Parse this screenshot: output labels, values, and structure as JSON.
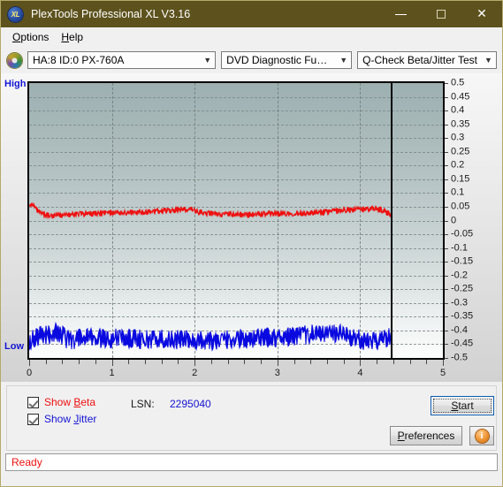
{
  "window": {
    "title": "PlexTools Professional XL V3.16",
    "icon": "xl-app-icon",
    "titlebar_color": "#5d521d",
    "controls": {
      "minimize": "minimize-icon",
      "maximize": "maximize-icon",
      "close": "close-icon"
    }
  },
  "menubar": {
    "items": [
      {
        "label": "Options",
        "accel": "O"
      },
      {
        "label": "Help",
        "accel": "H"
      }
    ]
  },
  "toolbar": {
    "disc_icon": "optical-disc-icon",
    "drive_select": {
      "value": "HA:8 ID:0  PX-760A",
      "chevron": "chevron-down-icon"
    },
    "function_select": {
      "value": "DVD Diagnostic Functions",
      "chevron": "chevron-down-icon"
    },
    "test_select": {
      "value": "Q-Check Beta/Jitter Test",
      "chevron": "chevron-down-icon"
    }
  },
  "chart_axis": {
    "high_label": "High",
    "low_label": "Low",
    "y_labels": [
      "0.5",
      "0.45",
      "0.4",
      "0.35",
      "0.3",
      "0.25",
      "0.2",
      "0.15",
      "0.1",
      "0.05",
      "0",
      "-0.05",
      "-0.1",
      "-0.15",
      "-0.2",
      "-0.25",
      "-0.3",
      "-0.35",
      "-0.4",
      "-0.45",
      "-0.5"
    ],
    "x_labels": [
      "0",
      "1",
      "2",
      "3",
      "4",
      "5"
    ]
  },
  "chart_data": {
    "type": "line",
    "title": "Q-Check Beta/Jitter Test",
    "xlabel": "",
    "ylabel": "",
    "xlim": [
      0,
      5
    ],
    "ylim": [
      -0.5,
      0.5
    ],
    "ytick_step": 0.05,
    "xtick_step": 1,
    "grid": true,
    "legend": [
      "Show Beta",
      "Show Jitter"
    ],
    "legend_position": "below-plot-left",
    "data_end_x": 4.37,
    "annotations": [
      {
        "text": "High",
        "position": "top-left-outside",
        "color": "#1414d2"
      },
      {
        "text": "Low",
        "position": "bottom-left-outside",
        "color": "#1414d2"
      }
    ],
    "series": [
      {
        "name": "Beta",
        "color": "#ee1111",
        "visible": true,
        "x": [
          0.0,
          0.04,
          0.08,
          0.12,
          0.16,
          0.2,
          0.25,
          0.3,
          0.35,
          0.4,
          0.45,
          0.5,
          0.55,
          0.6,
          0.65,
          0.7,
          0.75,
          0.8,
          0.85,
          0.9,
          0.95,
          1.0,
          1.05,
          1.1,
          1.15,
          1.2,
          1.25,
          1.3,
          1.35,
          1.4,
          1.45,
          1.5,
          1.55,
          1.6,
          1.65,
          1.7,
          1.75,
          1.8,
          1.85,
          1.9,
          1.95,
          2.0,
          2.05,
          2.1,
          2.15,
          2.2,
          2.25,
          2.3,
          2.35,
          2.4,
          2.45,
          2.5,
          2.55,
          2.6,
          2.65,
          2.7,
          2.75,
          2.8,
          2.85,
          2.9,
          2.95,
          3.0,
          3.05,
          3.1,
          3.15,
          3.2,
          3.25,
          3.3,
          3.35,
          3.4,
          3.45,
          3.5,
          3.55,
          3.6,
          3.65,
          3.7,
          3.75,
          3.8,
          3.85,
          3.9,
          3.95,
          4.0,
          4.05,
          4.1,
          4.15,
          4.2,
          4.25,
          4.3,
          4.33,
          4.36
        ],
        "values": [
          0.062,
          0.058,
          0.04,
          0.03,
          0.024,
          0.02,
          0.018,
          0.018,
          0.019,
          0.02,
          0.021,
          0.022,
          0.023,
          0.024,
          0.024,
          0.025,
          0.025,
          0.026,
          0.026,
          0.027,
          0.027,
          0.028,
          0.028,
          0.028,
          0.029,
          0.029,
          0.03,
          0.03,
          0.031,
          0.031,
          0.032,
          0.033,
          0.034,
          0.035,
          0.036,
          0.037,
          0.038,
          0.039,
          0.04,
          0.04,
          0.039,
          0.035,
          0.03,
          0.027,
          0.026,
          0.025,
          0.024,
          0.024,
          0.023,
          0.023,
          0.023,
          0.022,
          0.022,
          0.022,
          0.021,
          0.021,
          0.022,
          0.023,
          0.024,
          0.025,
          0.026,
          0.026,
          0.026,
          0.026,
          0.026,
          0.026,
          0.027,
          0.027,
          0.027,
          0.028,
          0.028,
          0.029,
          0.03,
          0.031,
          0.033,
          0.035,
          0.037,
          0.038,
          0.039,
          0.039,
          0.04,
          0.04,
          0.041,
          0.042,
          0.043,
          0.042,
          0.039,
          0.034,
          0.028,
          0.024
        ],
        "noise_amplitude": 0.012
      },
      {
        "name": "Jitter",
        "color": "#0a0ae0",
        "visible": true,
        "x": [
          0.0,
          0.04,
          0.08,
          0.12,
          0.16,
          0.2,
          0.25,
          0.3,
          0.35,
          0.4,
          0.45,
          0.5,
          0.55,
          0.6,
          0.65,
          0.7,
          0.75,
          0.8,
          0.85,
          0.9,
          0.95,
          1.0,
          1.05,
          1.1,
          1.15,
          1.2,
          1.25,
          1.3,
          1.35,
          1.4,
          1.45,
          1.5,
          1.55,
          1.6,
          1.65,
          1.7,
          1.75,
          1.8,
          1.85,
          1.9,
          1.95,
          2.0,
          2.05,
          2.1,
          2.15,
          2.2,
          2.25,
          2.3,
          2.35,
          2.4,
          2.45,
          2.5,
          2.55,
          2.6,
          2.65,
          2.7,
          2.75,
          2.8,
          2.85,
          2.9,
          2.95,
          3.0,
          3.05,
          3.1,
          3.15,
          3.2,
          3.25,
          3.3,
          3.35,
          3.4,
          3.45,
          3.5,
          3.55,
          3.6,
          3.65,
          3.7,
          3.75,
          3.8,
          3.85,
          3.9,
          3.95,
          4.0,
          4.05,
          4.1,
          4.15,
          4.2,
          4.25,
          4.3,
          4.33,
          4.36
        ],
        "values": [
          -0.44,
          -0.432,
          -0.424,
          -0.42,
          -0.418,
          -0.416,
          -0.414,
          -0.41,
          -0.406,
          -0.418,
          -0.43,
          -0.434,
          -0.432,
          -0.43,
          -0.428,
          -0.428,
          -0.426,
          -0.426,
          -0.428,
          -0.428,
          -0.43,
          -0.428,
          -0.426,
          -0.428,
          -0.43,
          -0.428,
          -0.428,
          -0.43,
          -0.43,
          -0.432,
          -0.432,
          -0.43,
          -0.43,
          -0.43,
          -0.432,
          -0.434,
          -0.434,
          -0.432,
          -0.432,
          -0.434,
          -0.436,
          -0.436,
          -0.434,
          -0.434,
          -0.434,
          -0.436,
          -0.436,
          -0.436,
          -0.434,
          -0.432,
          -0.432,
          -0.432,
          -0.43,
          -0.43,
          -0.43,
          -0.428,
          -0.428,
          -0.428,
          -0.426,
          -0.426,
          -0.424,
          -0.424,
          -0.422,
          -0.422,
          -0.422,
          -0.42,
          -0.42,
          -0.418,
          -0.416,
          -0.414,
          -0.414,
          -0.412,
          -0.412,
          -0.41,
          -0.41,
          -0.412,
          -0.414,
          -0.416,
          -0.42,
          -0.424,
          -0.428,
          -0.434,
          -0.44,
          -0.442,
          -0.438,
          -0.434,
          -0.43,
          -0.428,
          -0.426,
          -0.424
        ],
        "noise_amplitude": 0.04
      }
    ]
  },
  "controls": {
    "show_beta": {
      "label_pre": "Show ",
      "accel": "B",
      "label_post": "eta",
      "checked": true,
      "color": "#ee1111"
    },
    "show_jitter": {
      "label_pre": "Show ",
      "accel": "J",
      "label_post": "itter",
      "checked": true,
      "color": "#1414d2"
    },
    "lsn_label": "LSN:",
    "lsn_value": "2295040",
    "start_button": {
      "pre": "",
      "accel": "S",
      "post": "tart"
    },
    "preferences_button": {
      "pre": "",
      "accel": "P",
      "post": "references"
    },
    "info_button": "info-icon"
  },
  "statusbar": {
    "text": "Ready",
    "color": "#ee1111"
  }
}
